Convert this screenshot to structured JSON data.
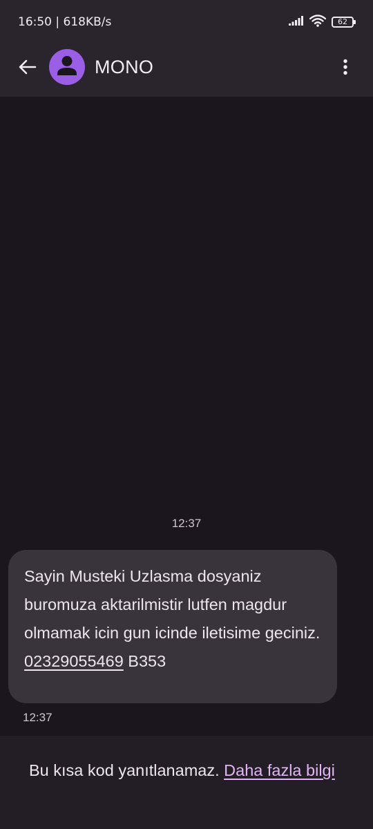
{
  "status_bar": {
    "time": "16:50",
    "network_speed": "618KB/s",
    "battery_level": "62",
    "icons": [
      "signal-icon",
      "wifi-icon",
      "battery-icon"
    ]
  },
  "app_bar": {
    "contact_name": "MONO",
    "avatar_color": "#9b5fe6",
    "icons": [
      "back-arrow-icon",
      "person-icon",
      "more-vert-icon"
    ]
  },
  "conversation": {
    "date_stamp": "12:37",
    "message": {
      "text": " Sayin Musteki Uzlasma dosyaniz buromuza aktarilmistir lutfen magdur olmamak icin gun icinde iletisime geciniz. ",
      "phone_link": "02329055469",
      "suffix": " B353",
      "time": "12:37"
    }
  },
  "footer": {
    "notice": "Bu kısa kod yanıtlanamaz. ",
    "link": "Daha fazla bilgi",
    "link_color": "#e2b6f4"
  }
}
